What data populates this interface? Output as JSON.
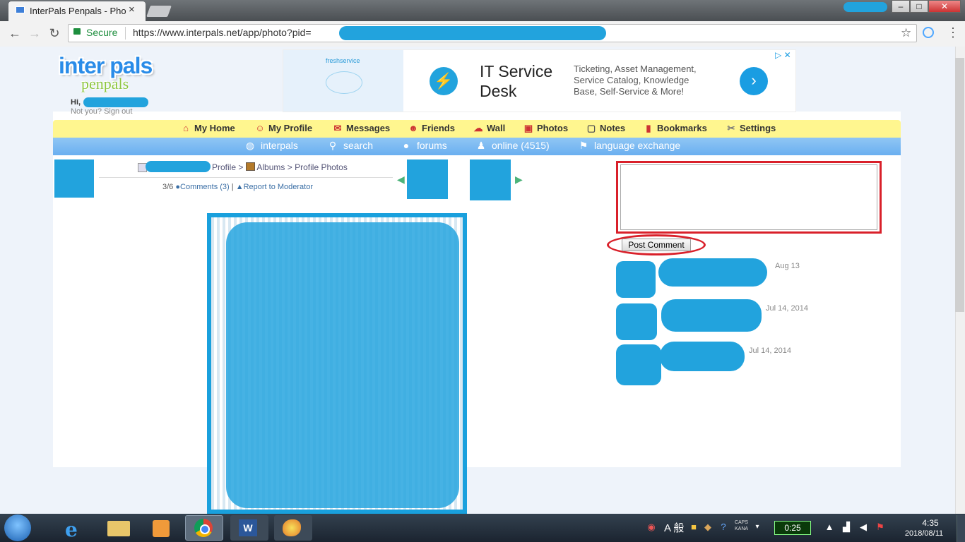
{
  "browser": {
    "tab_title": "InterPals Penpals - Pho",
    "close_glyph": "×",
    "security_label": "Secure",
    "url": "https://www.interpals.net/app/photo?pid="
  },
  "window_controls": {
    "minimize": "–",
    "maximize": "□",
    "close": "✕"
  },
  "site": {
    "logo_top": "inter pals",
    "logo_bottom": "penpals",
    "greeting": "Hi,",
    "greeting_end": "!",
    "signout": "Not you? Sign out"
  },
  "ad": {
    "brand": "freshservice",
    "title": "IT Service Desk",
    "description": "Ticketing, Asset Management, Service Catalog, Knowledge Base, Self-Service & More!"
  },
  "nav_primary": [
    {
      "label": "My Home",
      "icon": "home-icon"
    },
    {
      "label": "My Profile",
      "icon": "profile-icon"
    },
    {
      "label": "Messages",
      "icon": "envelope-icon"
    },
    {
      "label": "Friends",
      "icon": "friends-icon"
    },
    {
      "label": "Wall",
      "icon": "wall-icon"
    },
    {
      "label": "Photos",
      "icon": "photos-icon"
    },
    {
      "label": "Notes",
      "icon": "notes-icon"
    },
    {
      "label": "Bookmarks",
      "icon": "bookmark-icon"
    },
    {
      "label": "Settings",
      "icon": "settings-icon"
    }
  ],
  "nav_secondary": [
    {
      "label": "interpals",
      "icon": "globe-icon"
    },
    {
      "label": "search",
      "icon": "search-icon"
    },
    {
      "label": "forums",
      "icon": "forums-icon"
    },
    {
      "label": "online (4515)",
      "icon": "online-icon"
    },
    {
      "label": "language exchange",
      "icon": "flags-icon"
    }
  ],
  "breadcrumb": {
    "profile": "Profile",
    "separator": ">",
    "albums": "Albums",
    "current": "Profile Photos"
  },
  "photo_stats": {
    "position": "3/6",
    "comments": "Comments (3)",
    "divider": "|",
    "report": "Report to Moderator"
  },
  "comment_form": {
    "text": "",
    "button": "Post Comment"
  },
  "comments": [
    {
      "date": "Aug 13"
    },
    {
      "date": "Jul 14, 2014"
    },
    {
      "date": "Jul 14, 2014"
    }
  ],
  "taskbar": {
    "ime_mode": "A 般",
    "ime_caps": "CAPS",
    "ime_kana": "KANA",
    "battery": "0:25",
    "time": "4:35",
    "date": "2018/08/11"
  },
  "colors": {
    "accent_nav_yellow": "#fff68f",
    "accent_nav_blue": "#7ab8f2",
    "annotation_red": "#d9202a",
    "redaction_blue": "#22a3dd"
  }
}
